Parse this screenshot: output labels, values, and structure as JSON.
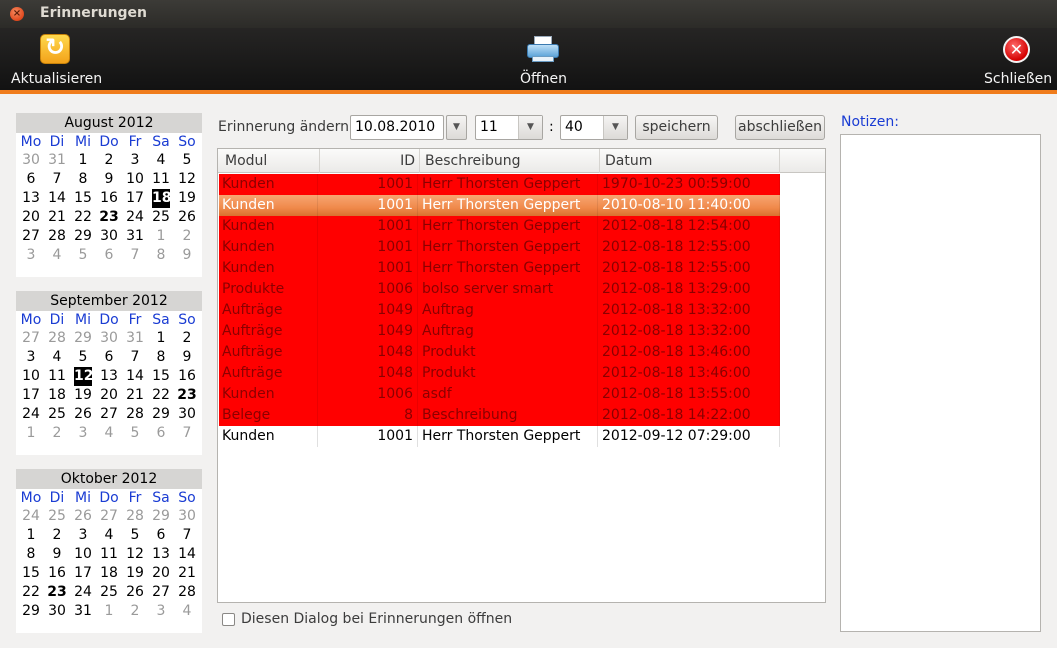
{
  "window": {
    "title": "Erinnerungen"
  },
  "toolbar": {
    "refresh_label": "Aktualisieren",
    "open_label": "Öffnen",
    "close_label": "Schließen"
  },
  "weekdays": [
    "Mo",
    "Di",
    "Mi",
    "Do",
    "Fr",
    "Sa",
    "So"
  ],
  "calendars": [
    {
      "title": "August 2012",
      "days": [
        {
          "d": "30",
          "g": true
        },
        {
          "d": "31",
          "g": true
        },
        {
          "d": "1"
        },
        {
          "d": "2"
        },
        {
          "d": "3"
        },
        {
          "d": "4"
        },
        {
          "d": "5"
        },
        {
          "d": "6"
        },
        {
          "d": "7"
        },
        {
          "d": "8"
        },
        {
          "d": "9"
        },
        {
          "d": "10"
        },
        {
          "d": "11"
        },
        {
          "d": "12"
        },
        {
          "d": "13"
        },
        {
          "d": "14"
        },
        {
          "d": "15"
        },
        {
          "d": "16"
        },
        {
          "d": "17"
        },
        {
          "d": "18",
          "sel": true
        },
        {
          "d": "19"
        },
        {
          "d": "20"
        },
        {
          "d": "21"
        },
        {
          "d": "22"
        },
        {
          "d": "23",
          "b": true
        },
        {
          "d": "24"
        },
        {
          "d": "25"
        },
        {
          "d": "26"
        },
        {
          "d": "27"
        },
        {
          "d": "28"
        },
        {
          "d": "29"
        },
        {
          "d": "30"
        },
        {
          "d": "31"
        },
        {
          "d": "1",
          "g": true
        },
        {
          "d": "2",
          "g": true
        },
        {
          "d": "3",
          "g": true
        },
        {
          "d": "4",
          "g": true
        },
        {
          "d": "5",
          "g": true
        },
        {
          "d": "6",
          "g": true
        },
        {
          "d": "7",
          "g": true
        },
        {
          "d": "8",
          "g": true
        },
        {
          "d": "9",
          "g": true
        }
      ]
    },
    {
      "title": "September 2012",
      "days": [
        {
          "d": "27",
          "g": true
        },
        {
          "d": "28",
          "g": true
        },
        {
          "d": "29",
          "g": true
        },
        {
          "d": "30",
          "g": true
        },
        {
          "d": "31",
          "g": true
        },
        {
          "d": "1"
        },
        {
          "d": "2"
        },
        {
          "d": "3"
        },
        {
          "d": "4"
        },
        {
          "d": "5"
        },
        {
          "d": "6"
        },
        {
          "d": "7"
        },
        {
          "d": "8"
        },
        {
          "d": "9"
        },
        {
          "d": "10"
        },
        {
          "d": "11"
        },
        {
          "d": "12",
          "sel": true
        },
        {
          "d": "13"
        },
        {
          "d": "14"
        },
        {
          "d": "15"
        },
        {
          "d": "16"
        },
        {
          "d": "17"
        },
        {
          "d": "18"
        },
        {
          "d": "19"
        },
        {
          "d": "20"
        },
        {
          "d": "21"
        },
        {
          "d": "22"
        },
        {
          "d": "23",
          "b": true
        },
        {
          "d": "24"
        },
        {
          "d": "25"
        },
        {
          "d": "26"
        },
        {
          "d": "27"
        },
        {
          "d": "28"
        },
        {
          "d": "29"
        },
        {
          "d": "30"
        },
        {
          "d": "1",
          "g": true
        },
        {
          "d": "2",
          "g": true
        },
        {
          "d": "3",
          "g": true
        },
        {
          "d": "4",
          "g": true
        },
        {
          "d": "5",
          "g": true
        },
        {
          "d": "6",
          "g": true
        },
        {
          "d": "7",
          "g": true
        }
      ]
    },
    {
      "title": "Oktober 2012",
      "days": [
        {
          "d": "24",
          "g": true
        },
        {
          "d": "25",
          "g": true
        },
        {
          "d": "26",
          "g": true
        },
        {
          "d": "27",
          "g": true
        },
        {
          "d": "28",
          "g": true
        },
        {
          "d": "29",
          "g": true
        },
        {
          "d": "30",
          "g": true
        },
        {
          "d": "1"
        },
        {
          "d": "2"
        },
        {
          "d": "3"
        },
        {
          "d": "4"
        },
        {
          "d": "5"
        },
        {
          "d": "6"
        },
        {
          "d": "7"
        },
        {
          "d": "8"
        },
        {
          "d": "9"
        },
        {
          "d": "10"
        },
        {
          "d": "11"
        },
        {
          "d": "12"
        },
        {
          "d": "13"
        },
        {
          "d": "14"
        },
        {
          "d": "15"
        },
        {
          "d": "16"
        },
        {
          "d": "17"
        },
        {
          "d": "18"
        },
        {
          "d": "19"
        },
        {
          "d": "20"
        },
        {
          "d": "21"
        },
        {
          "d": "22"
        },
        {
          "d": "23",
          "b": true
        },
        {
          "d": "24"
        },
        {
          "d": "25"
        },
        {
          "d": "26"
        },
        {
          "d": "27"
        },
        {
          "d": "28"
        },
        {
          "d": "29"
        },
        {
          "d": "30"
        },
        {
          "d": "31"
        },
        {
          "d": "1",
          "g": true
        },
        {
          "d": "2",
          "g": true
        },
        {
          "d": "3",
          "g": true
        },
        {
          "d": "4",
          "g": true
        }
      ]
    }
  ],
  "controls": {
    "label": "Erinnerung ändern:",
    "date": "10.08.2010",
    "hour": "11",
    "minute": "40",
    "colon": ":",
    "save_label": "speichern",
    "complete_label": "abschließen"
  },
  "table": {
    "columns": [
      "Modul",
      "ID",
      "Beschreibung",
      "Datum"
    ],
    "rows": [
      {
        "modul": "Kunden",
        "id": "1001",
        "beschreibung": "Herr Thorsten Geppert",
        "datum": "1970-10-23 00:59:00",
        "state": "overdue"
      },
      {
        "modul": "Kunden",
        "id": "1001",
        "beschreibung": "Herr Thorsten Geppert",
        "datum": "2010-08-10 11:40:00",
        "state": "selected"
      },
      {
        "modul": "Kunden",
        "id": "1001",
        "beschreibung": "Herr Thorsten Geppert",
        "datum": "2012-08-18 12:54:00",
        "state": "overdue"
      },
      {
        "modul": "Kunden",
        "id": "1001",
        "beschreibung": "Herr Thorsten Geppert",
        "datum": "2012-08-18 12:55:00",
        "state": "overdue"
      },
      {
        "modul": "Kunden",
        "id": "1001",
        "beschreibung": "Herr Thorsten Geppert",
        "datum": "2012-08-18 12:55:00",
        "state": "overdue"
      },
      {
        "modul": "Produkte",
        "id": "1006",
        "beschreibung": "bolso server smart",
        "datum": "2012-08-18 13:29:00",
        "state": "overdue"
      },
      {
        "modul": "Aufträge",
        "id": "1049",
        "beschreibung": "Auftrag",
        "datum": "2012-08-18 13:32:00",
        "state": "overdue"
      },
      {
        "modul": "Aufträge",
        "id": "1049",
        "beschreibung": "Auftrag",
        "datum": "2012-08-18 13:32:00",
        "state": "overdue"
      },
      {
        "modul": "Aufträge",
        "id": "1048",
        "beschreibung": "Produkt",
        "datum": "2012-08-18 13:46:00",
        "state": "overdue"
      },
      {
        "modul": "Aufträge",
        "id": "1048",
        "beschreibung": "Produkt",
        "datum": "2012-08-18 13:46:00",
        "state": "overdue"
      },
      {
        "modul": "Kunden",
        "id": "1006",
        "beschreibung": "asdf",
        "datum": "2012-08-18 13:55:00",
        "state": "overdue"
      },
      {
        "modul": "Belege",
        "id": "8",
        "beschreibung": "Beschreibung",
        "datum": "2012-08-18 14:22:00",
        "state": "overdue"
      },
      {
        "modul": "Kunden",
        "id": "1001",
        "beschreibung": "Herr Thorsten Geppert",
        "datum": "2012-09-12 07:29:00",
        "state": "normal"
      }
    ]
  },
  "checkbox": {
    "label": "Diesen Dialog bei Erinnerungen öffnen",
    "checked": false
  },
  "notes": {
    "label": "Notizen:",
    "value": ""
  },
  "colors": {
    "overdue_bg": "#ff0000",
    "overdue_text": "#8b0000",
    "selected_bg": "#f08a4b",
    "accent": "#f07c1c",
    "weekday": "#1a3cd3"
  }
}
